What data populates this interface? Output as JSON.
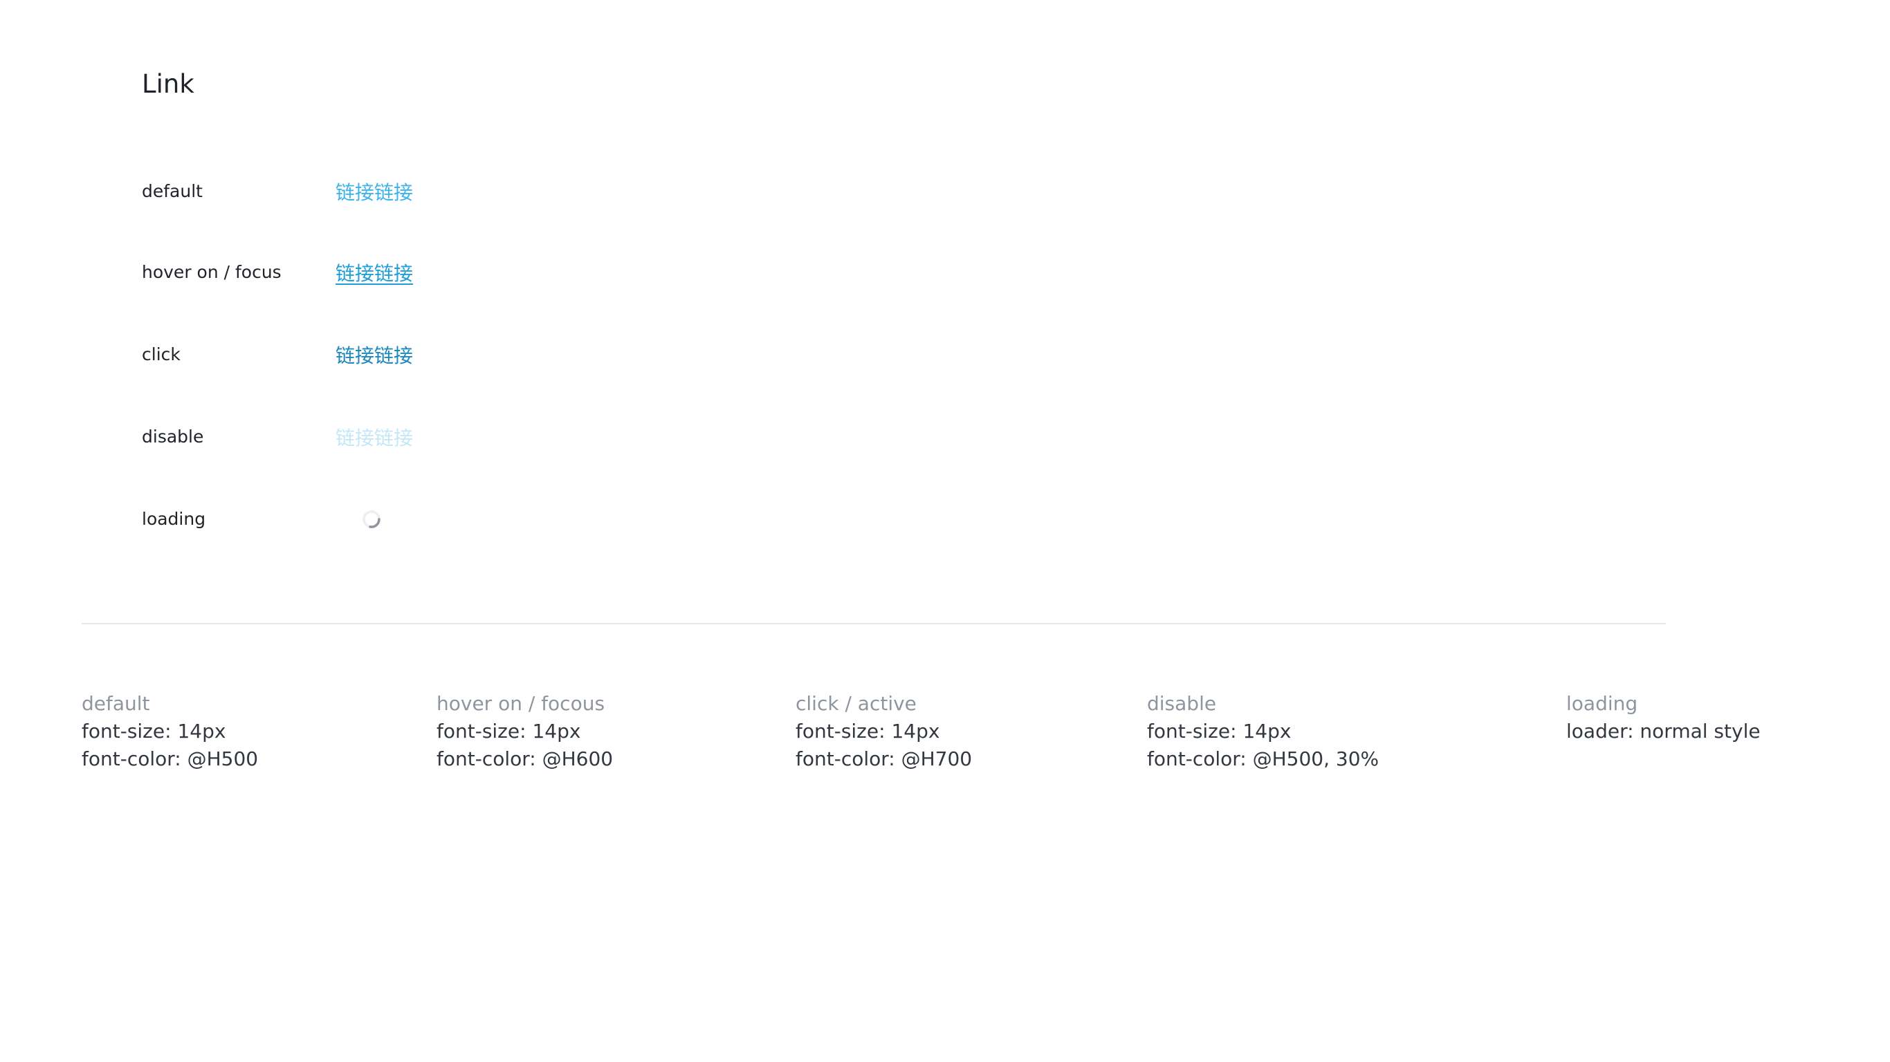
{
  "title": "Link",
  "states": [
    {
      "label": "default",
      "link_text": "链接链接"
    },
    {
      "label": "hover on / focus",
      "link_text": "链接链接"
    },
    {
      "label": "click",
      "link_text": "链接链接"
    },
    {
      "label": "disable",
      "link_text": "链接链接"
    },
    {
      "label": "loading",
      "link_text": ""
    }
  ],
  "colors": {
    "default": "#3eb3ea",
    "hover": "#1e9ed8",
    "active": "#1a87bf",
    "disabled_opacity": 0.3,
    "spinner": "#8f959e"
  },
  "specs": [
    {
      "title": "default",
      "lines": [
        "font-size: 14px",
        "font-color: @H500"
      ]
    },
    {
      "title": "hover on / focous",
      "lines": [
        "font-size: 14px",
        "font-color: @H600"
      ]
    },
    {
      "title": "click / active",
      "lines": [
        "font-size: 14px",
        "font-color: @H700"
      ]
    },
    {
      "title": "disable",
      "lines": [
        "font-size: 14px",
        "font-color: @H500, 30%"
      ]
    },
    {
      "title": "loading",
      "lines": [
        "loader: normal style"
      ]
    }
  ]
}
